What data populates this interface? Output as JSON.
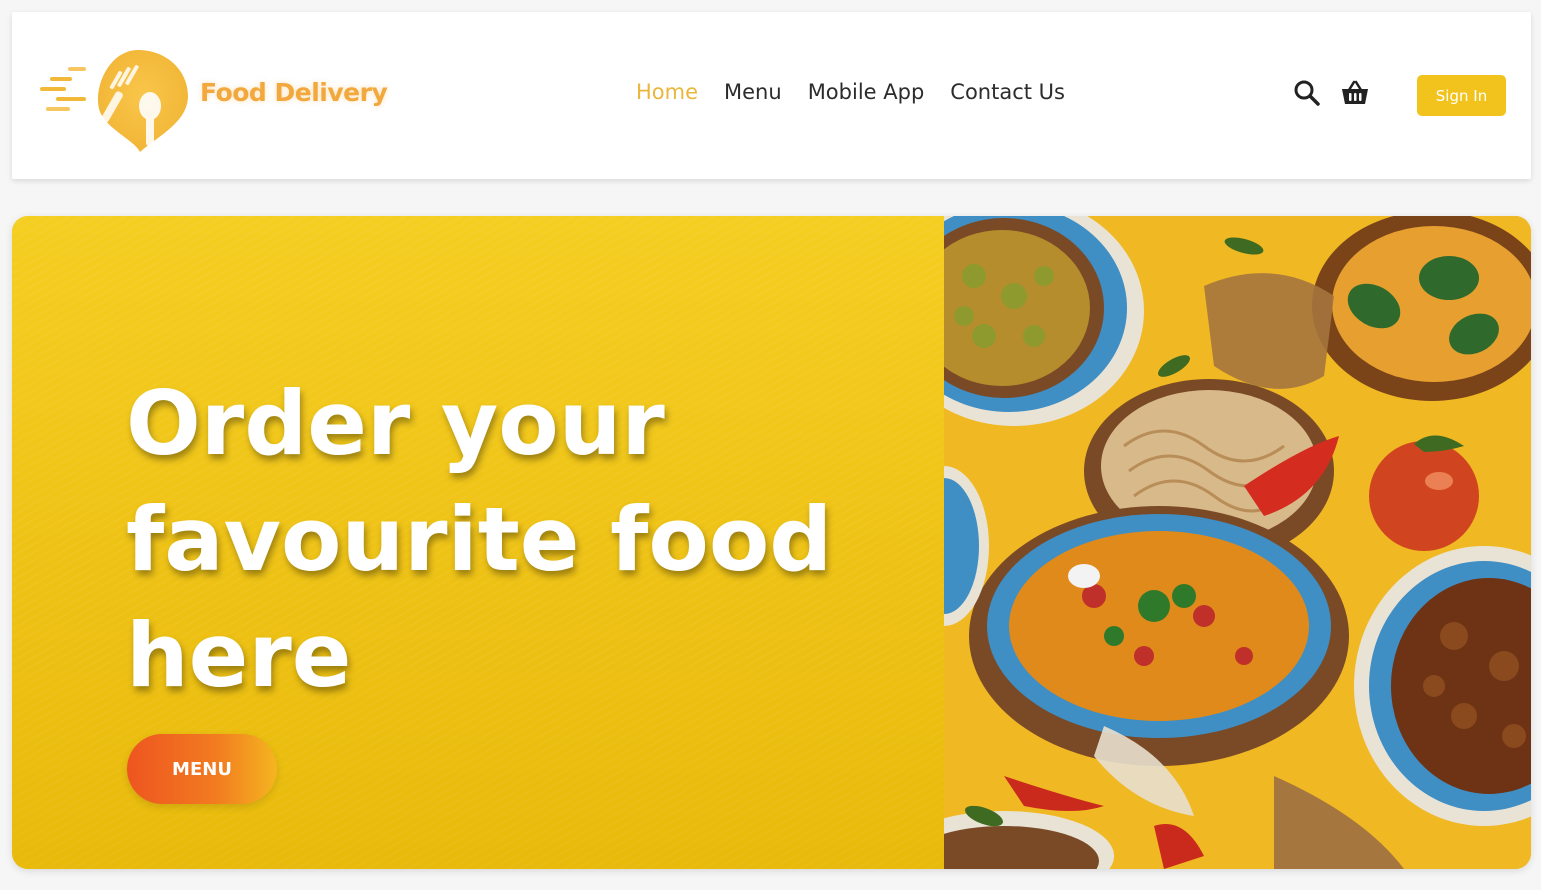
{
  "brand": {
    "name": "Food Delivery",
    "accent": "#f2a83c",
    "logo_icon": "fork-spoon-location-pin-icon"
  },
  "nav": {
    "items": [
      {
        "label": "Home",
        "active": true
      },
      {
        "label": "Menu",
        "active": false
      },
      {
        "label": "Mobile App",
        "active": false
      },
      {
        "label": "Contact Us",
        "active": false
      }
    ],
    "active_color": "#eab73c"
  },
  "header_actions": {
    "search_icon": "search-icon",
    "basket_icon": "basket-icon",
    "sign_in_label": "Sign In",
    "sign_in_color": "#f2c31c"
  },
  "hero": {
    "title": "Order your favourite food here",
    "button_label": "MENU",
    "background_color": "#f0c416",
    "image": "illustrated-food-bowls"
  }
}
